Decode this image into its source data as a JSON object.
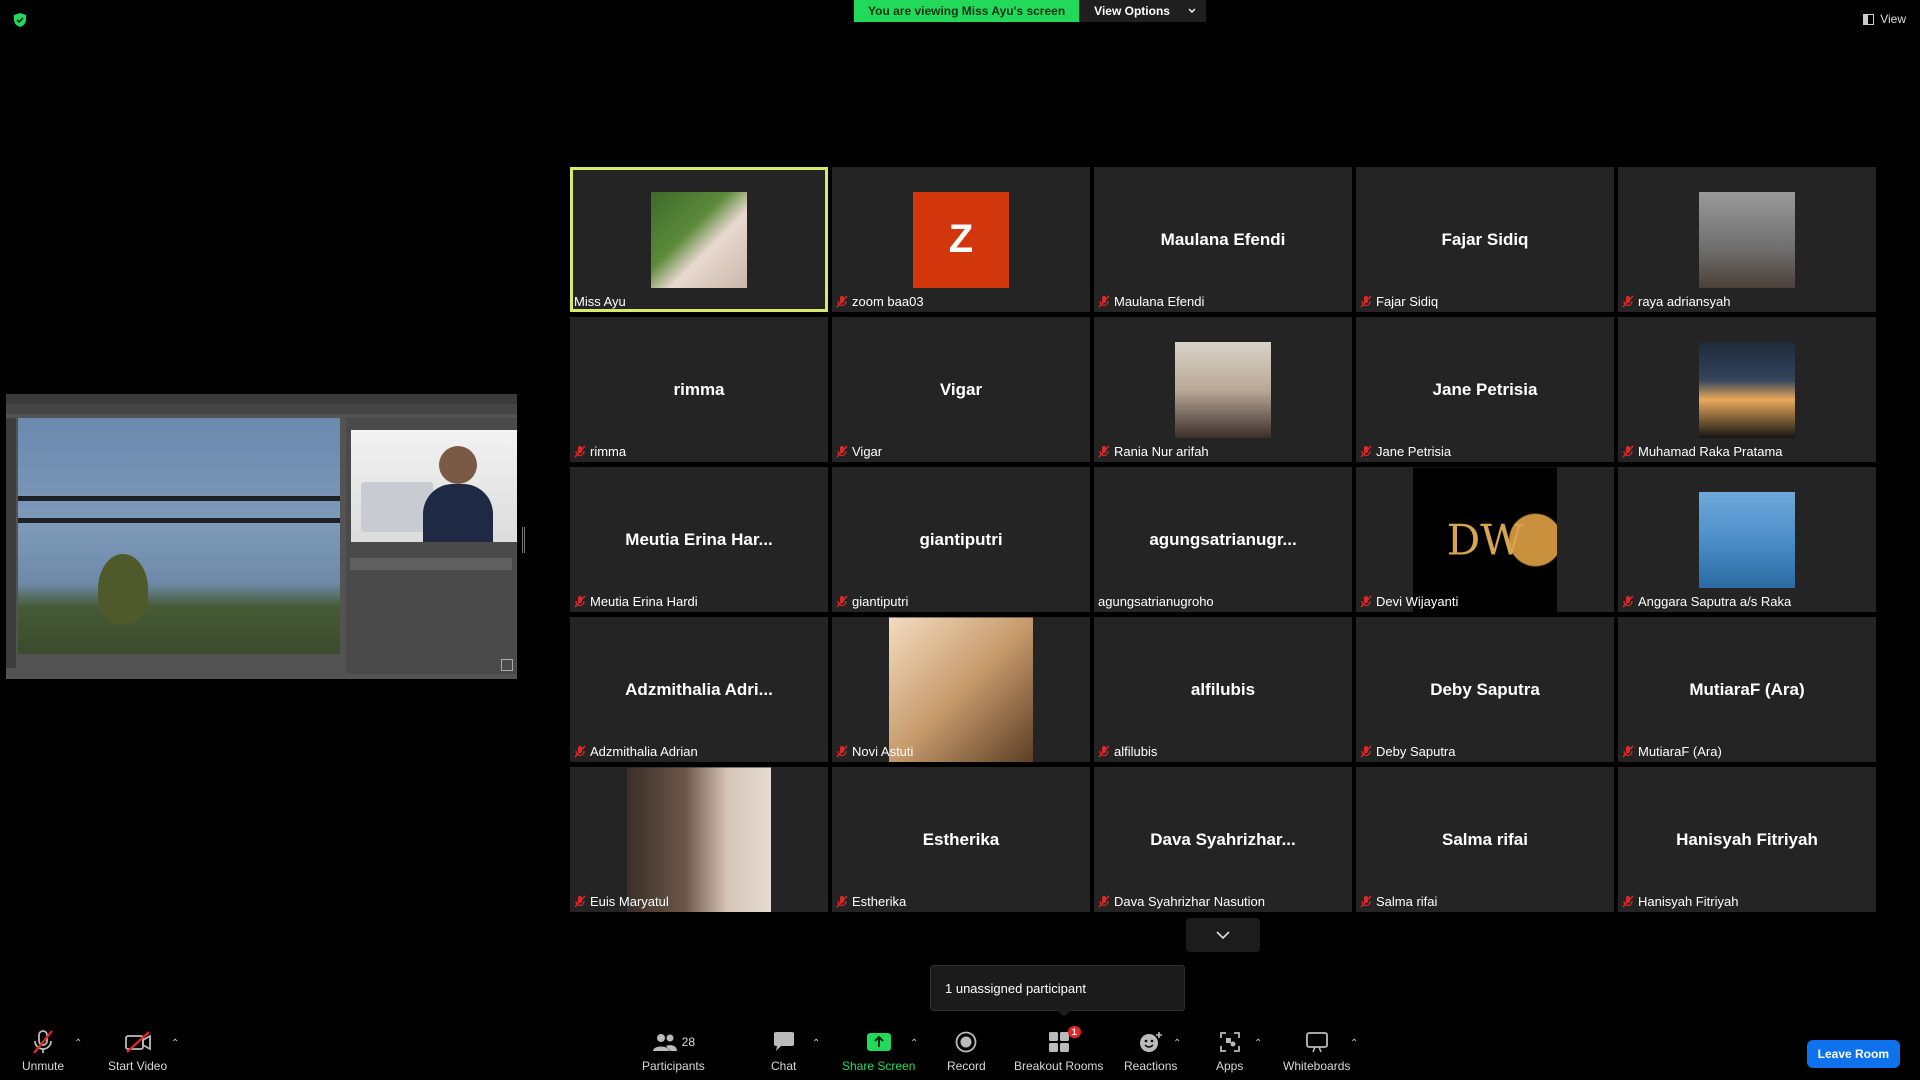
{
  "top": {
    "banner_text": "You are viewing Miss Ayu's screen",
    "view_options_label": "View Options",
    "view_label": "View"
  },
  "participants": [
    {
      "tile_name": "",
      "tag": "Miss Ayu",
      "muted": false,
      "kind": "photo",
      "photo": "woman-in-garden"
    },
    {
      "tile_name": "",
      "tag": "zoom baa03",
      "muted": true,
      "kind": "letter",
      "letter": "Z"
    },
    {
      "tile_name": "Maulana Efendi",
      "tag": "Maulana Efendi",
      "muted": true,
      "kind": "name"
    },
    {
      "tile_name": "Fajar Sidiq",
      "tag": "Fajar Sidiq",
      "muted": true,
      "kind": "name"
    },
    {
      "tile_name": "",
      "tag": "raya adriansyah",
      "muted": true,
      "kind": "photo",
      "photo": "grey-room"
    },
    {
      "tile_name": "rimma",
      "tag": "rimma",
      "muted": true,
      "kind": "name"
    },
    {
      "tile_name": "Vigar",
      "tag": "Vigar",
      "muted": true,
      "kind": "name"
    },
    {
      "tile_name": "",
      "tag": "Rania Nur arifah",
      "muted": true,
      "kind": "photo",
      "photo": "smiling-woman"
    },
    {
      "tile_name": "Jane Petrisia",
      "tag": "Jane Petrisia",
      "muted": true,
      "kind": "name"
    },
    {
      "tile_name": "",
      "tag": "Muhamad Raka Pratama",
      "muted": true,
      "kind": "photo",
      "photo": "sunset-silhouette"
    },
    {
      "tile_name": "Meutia Erina Har...",
      "tag": "Meutia Erina Hardi",
      "muted": true,
      "kind": "name"
    },
    {
      "tile_name": "giantiputri",
      "tag": "giantiputri",
      "muted": true,
      "kind": "name"
    },
    {
      "tile_name": "agungsatrianugr...",
      "tag": "agungsatrianugroho",
      "muted": false,
      "kind": "name"
    },
    {
      "tile_name": "",
      "tag": "Devi Wijayanti",
      "muted": true,
      "kind": "logo",
      "logo_text": "DW"
    },
    {
      "tile_name": "",
      "tag": "Anggara Saputra a/s Raka",
      "muted": true,
      "kind": "photo",
      "photo": "jetski"
    },
    {
      "tile_name": "Adzmithalia Adri...",
      "tag": "Adzmithalia Adrian",
      "muted": true,
      "kind": "name"
    },
    {
      "tile_name": "",
      "tag": "Novi Astuti",
      "muted": true,
      "kind": "photo",
      "photo": "golden-hill"
    },
    {
      "tile_name": "alfilubis",
      "tag": "alfilubis",
      "muted": true,
      "kind": "name"
    },
    {
      "tile_name": "Deby Saputra",
      "tag": "Deby Saputra",
      "muted": true,
      "kind": "name"
    },
    {
      "tile_name": "MutiaraF (Ara)",
      "tag": "MutiaraF (Ara)",
      "muted": true,
      "kind": "name"
    },
    {
      "tile_name": "",
      "tag": "Euis Maryatul",
      "muted": true,
      "kind": "photo",
      "photo": "laughing-woman"
    },
    {
      "tile_name": "Estherika",
      "tag": "Estherika",
      "muted": true,
      "kind": "name"
    },
    {
      "tile_name": "Dava Syahrizhar...",
      "tag": "Dava Syahrizhar Nasution",
      "muted": true,
      "kind": "name"
    },
    {
      "tile_name": "Salma rifai",
      "tag": "Salma rifai",
      "muted": true,
      "kind": "name"
    },
    {
      "tile_name": "Hanisyah Fitriyah",
      "tag": "Hanisyah Fitriyah",
      "muted": true,
      "kind": "name"
    }
  ],
  "tooltip": {
    "text": "1 unassigned participant"
  },
  "toolbar": {
    "unmute": "Unmute",
    "start_video": "Start Video",
    "participants": "Participants",
    "participants_count": "28",
    "chat": "Chat",
    "share_screen": "Share Screen",
    "record": "Record",
    "breakout_rooms": "Breakout Rooms",
    "breakout_badge": "1",
    "reactions": "Reactions",
    "apps": "Apps",
    "whiteboards": "Whiteboards",
    "leave": "Leave Room"
  },
  "colors": {
    "banner_green": "#23d959",
    "active_speaker": "#d7ea6a",
    "tile_bg": "#242424",
    "leave_blue": "#0e72ed",
    "muted_red": "#e02828"
  }
}
